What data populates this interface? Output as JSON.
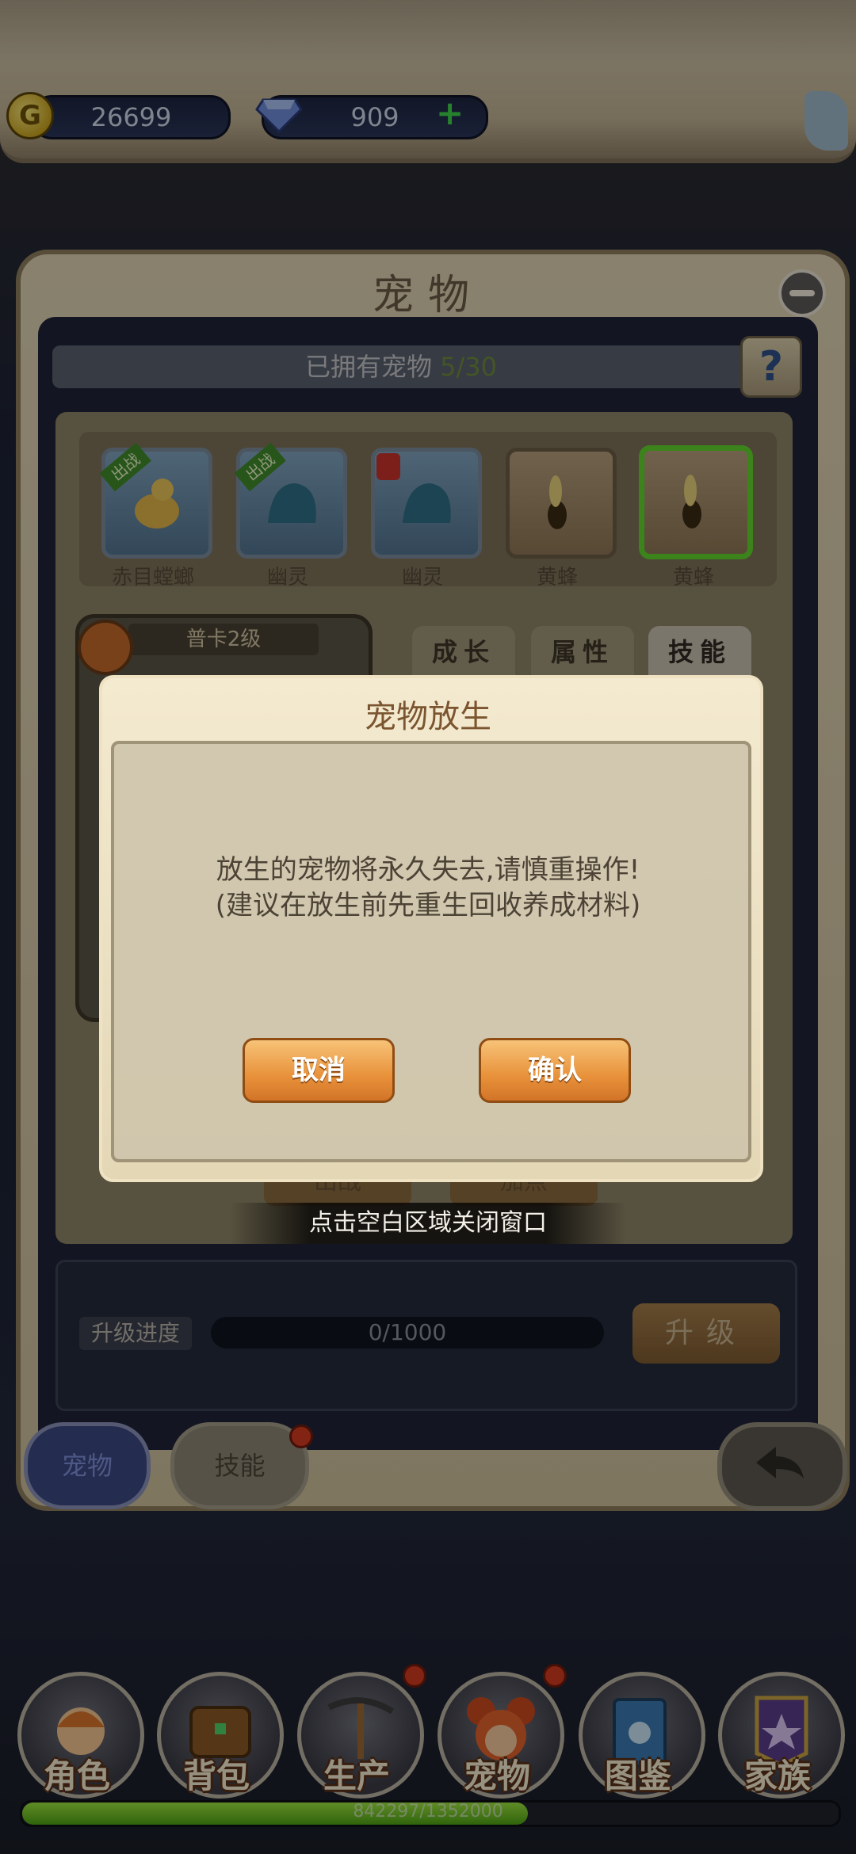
{
  "currency": {
    "gold": "26699",
    "gems": "909",
    "gold_icon": "G"
  },
  "panel": {
    "title": "宠物",
    "owned_label": "已拥有宠物",
    "owned_count": "5/30",
    "help_icon": "?"
  },
  "pets": [
    {
      "name": "赤目螳螂",
      "badge": "出战"
    },
    {
      "name": "幽灵",
      "badge": "出战"
    },
    {
      "name": "幽灵",
      "badge": ""
    },
    {
      "name": "黄蜂",
      "badge": ""
    },
    {
      "name": "黄蜂",
      "badge": ""
    }
  ],
  "detail_tabs": [
    "成长",
    "属性",
    "技能"
  ],
  "card": {
    "grade": "普卡2级"
  },
  "level": {
    "label": "升级进度",
    "progress": "0/1000",
    "upgrade_label": "升级"
  },
  "bottom_actions": {
    "deploy": "出战",
    "add_points": "加点"
  },
  "side_tabs": {
    "pet": "宠物",
    "skill": "技能"
  },
  "dialog": {
    "title": "宠物放生",
    "line1": "放生的宠物将永久失去,请慎重操作!",
    "line2": "(建议在放生前先重生回收养成材料)",
    "cancel": "取消",
    "confirm": "确认"
  },
  "hint": "点击空白区域关闭窗口",
  "nav": [
    "角色",
    "背包",
    "生产",
    "宠物",
    "图鉴",
    "家族"
  ],
  "exp": {
    "text": "842297/1352000",
    "fraction": 0.623
  },
  "colors": {
    "accent_green": "#3fd24a",
    "confirm_orange": "#e8913a",
    "selected_border": "#5fd42a"
  }
}
